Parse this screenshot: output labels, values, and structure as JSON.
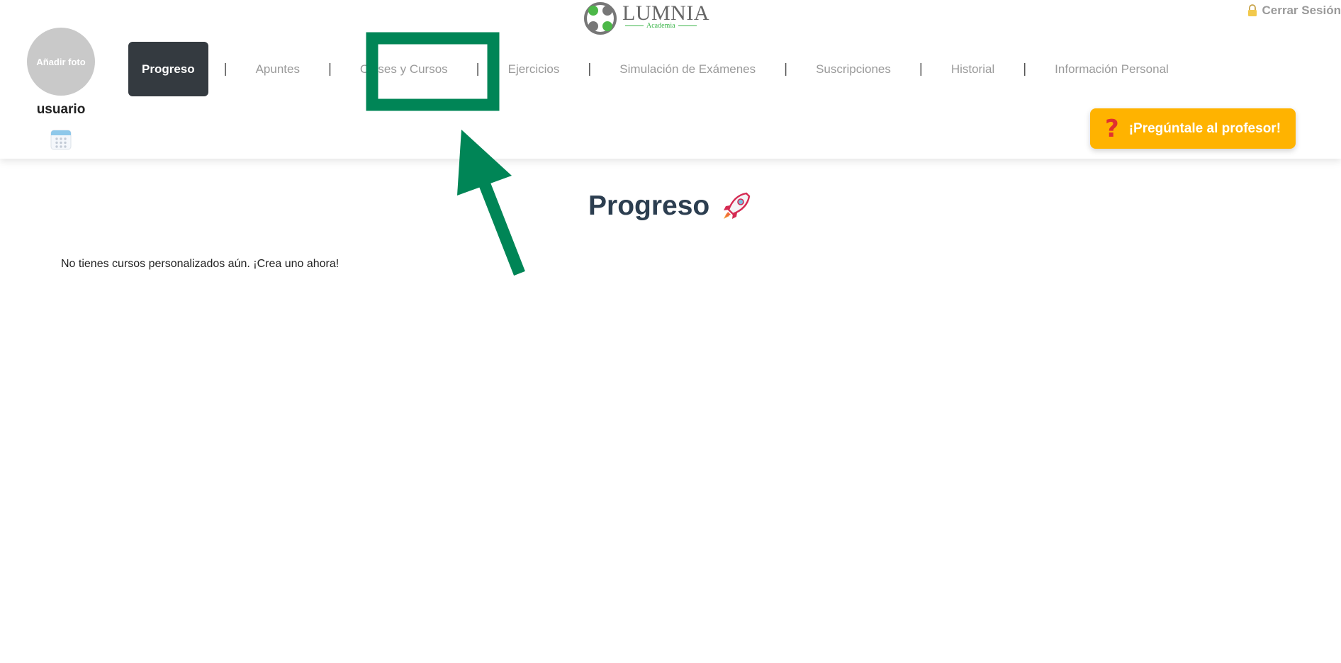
{
  "logo": {
    "name": "LUMNIA",
    "subtitle": "Academia"
  },
  "header": {
    "logout_label": "Cerrar Sesión"
  },
  "profile": {
    "photo_label": "Añadir foto",
    "username": "usuario"
  },
  "nav": {
    "items": [
      {
        "label": "Progreso",
        "active": true
      },
      {
        "label": "Apuntes"
      },
      {
        "label": "Clases y Cursos"
      },
      {
        "label": "Ejercicios"
      },
      {
        "label": "Simulación de Exámenes"
      },
      {
        "label": "Suscripciones"
      },
      {
        "label": "Historial"
      },
      {
        "label": "Información Personal"
      }
    ],
    "separator": "|"
  },
  "ask_button": {
    "label": "¡Pregúntale al profesor!",
    "icon": "question-icon"
  },
  "main": {
    "title": "Progreso",
    "title_icon": "rocket-icon",
    "empty_message": "No tienes cursos personalizados aún. ¡Crea uno ahora!"
  },
  "colors": {
    "nav_active_bg": "#343a40",
    "nav_text": "#9a9a9a",
    "ask_button_bg": "#ffb300",
    "title_text": "#2c3e50",
    "annotation": "#008556"
  }
}
